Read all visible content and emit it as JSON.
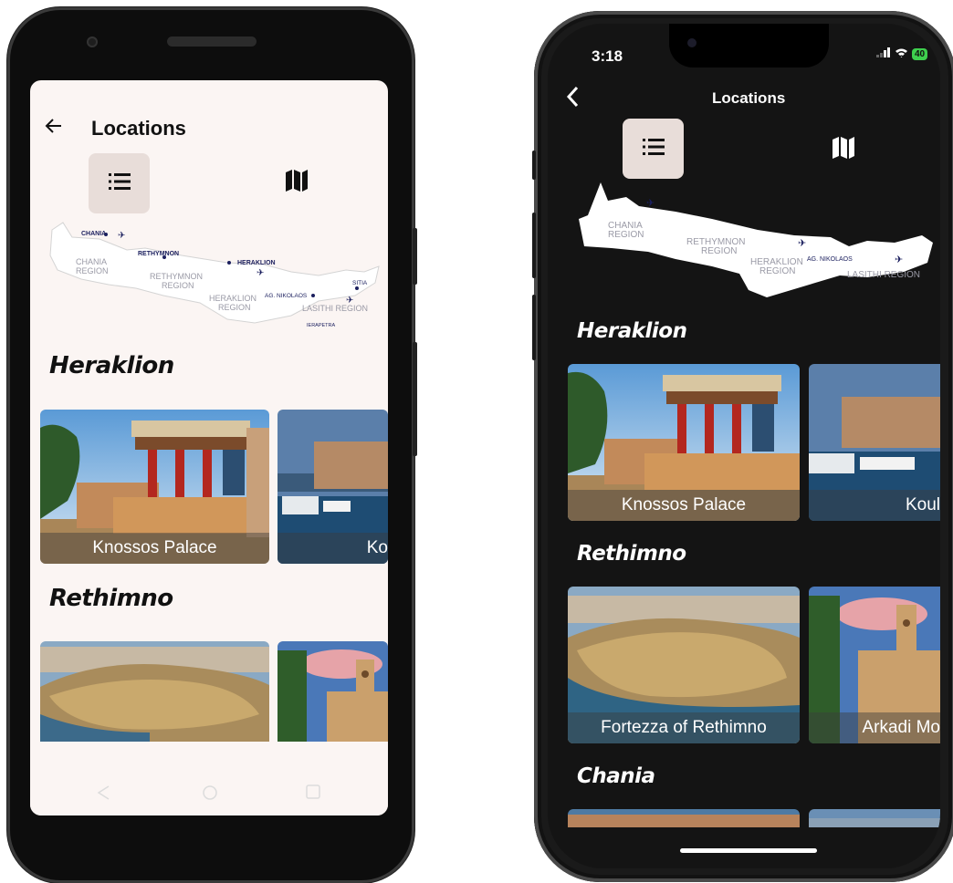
{
  "android": {
    "header": {
      "back_icon": "arrow-left-icon",
      "title": "Locations"
    },
    "view_toggle": {
      "list_icon": "list-icon",
      "map_icon": "map-icon",
      "selected": "list"
    },
    "map_labels": {
      "chania": "CHANIA",
      "chania_region": "CHANIA\nREGION",
      "rethymnon": "RETHYMNON",
      "rethymnon_region": "RETHYMNON\nREGION",
      "heraklion": "HERAKLION",
      "heraklion_region": "HERAKLION\nREGION",
      "ag_nikolaos": "AG. NIKOLAOS",
      "sitia": "SITIA",
      "lasithi_region": "LASITHI REGION",
      "ierapetra": "IERAPETRA"
    },
    "sections": [
      {
        "title": "Heraklion",
        "cards": [
          {
            "label": "Knossos Palace"
          },
          {
            "label": "Ko"
          }
        ]
      },
      {
        "title": "Rethimno",
        "cards": [
          {
            "label": ""
          },
          {
            "label": ""
          }
        ]
      }
    ]
  },
  "iphone": {
    "status": {
      "time": "3:18",
      "battery": "40"
    },
    "header": {
      "back_icon": "chevron-left-icon",
      "title": "Locations"
    },
    "view_toggle": {
      "list_icon": "list-icon",
      "map_icon": "map-icon",
      "selected": "list"
    },
    "map_labels": {
      "chania_region": "CHANIA\nREGION",
      "rethymnon_region": "RETHYMNON\nREGION",
      "heraklion_region": "HERAKLION\nREGION",
      "ag_nikolaos": "AG. NIKOLAOS",
      "lasithi_region": "LASITHI REGION"
    },
    "sections": [
      {
        "title": "Heraklion",
        "cards": [
          {
            "label": "Knossos Palace"
          },
          {
            "label": "Koul"
          }
        ]
      },
      {
        "title": "Rethimno",
        "cards": [
          {
            "label": "Fortezza of Rethimno"
          },
          {
            "label": "Arkadi Mo"
          }
        ]
      },
      {
        "title": "Chania",
        "cards": [
          {
            "label": ""
          },
          {
            "label": ""
          }
        ]
      }
    ]
  },
  "colors": {
    "accent_bg": "#e8ddd9",
    "light_bg": "#fbf5f3",
    "dark_bg": "#141414",
    "map_text": "#1b1f5e"
  }
}
